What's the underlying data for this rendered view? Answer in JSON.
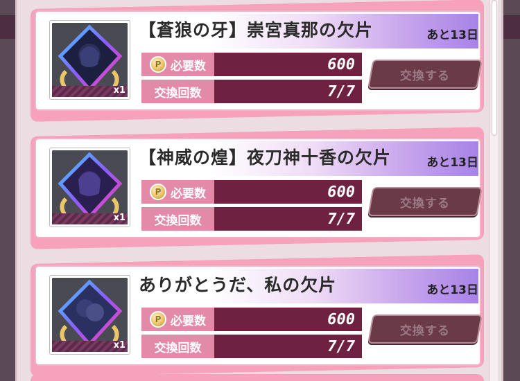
{
  "colors": {
    "card_border": "#f6a2bd",
    "label_bg": "#e38aa8",
    "value_bg": "#6f2142",
    "button_bg": "#6a3a48"
  },
  "items": [
    {
      "title": "【蒼狼の牙】崇宮真那の欠片",
      "days_left": "あと13日",
      "qty": "x1",
      "coin_glyph": "P",
      "required_label": "必要数",
      "required_value": "600",
      "exchange_count_label": "交換回数",
      "exchange_count_value": "7/7",
      "button_label": "交換する",
      "icon": "pointcoin-icon"
    },
    {
      "title": "【神威の煌】夜刀神十香の欠片",
      "days_left": "あと13日",
      "qty": "x1",
      "coin_glyph": "P",
      "required_label": "必要数",
      "required_value": "600",
      "exchange_count_label": "交換回数",
      "exchange_count_value": "7/7",
      "button_label": "交換する",
      "icon": "pointcoin-icon"
    },
    {
      "title": "ありがとうだ、私の欠片",
      "days_left": "あと13日",
      "qty": "x1",
      "coin_glyph": "P",
      "required_label": "必要数",
      "required_value": "600",
      "exchange_count_label": "交換回数",
      "exchange_count_value": "7/7",
      "button_label": "交換する",
      "icon": "pointcoin-icon"
    }
  ]
}
